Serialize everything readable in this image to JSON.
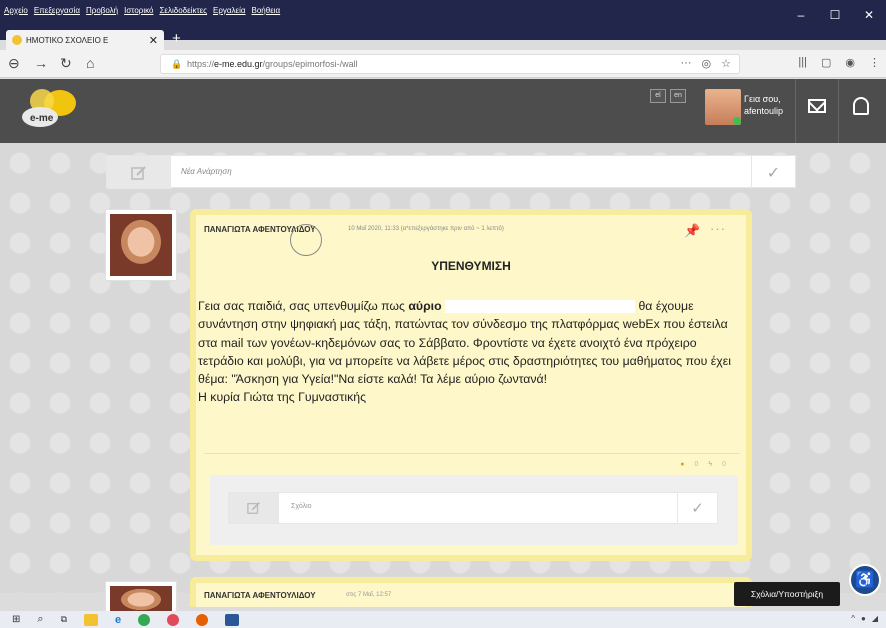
{
  "browser": {
    "menu": [
      "Αρχείο",
      "Επεξεργασία",
      "Προβολή",
      "Ιστορικό",
      "Σελιδοδείκτες",
      "Εργαλεία",
      "Βοήθεια"
    ],
    "tab_title": "ΗΜΟΤΙΚΟ ΣΧΟΛΕΙΟ Ε",
    "tab_close": "✕",
    "new_tab": "+",
    "url_prefix": "https://",
    "url_host": "e-me.edu.gr",
    "url_path": "/groups/epimorfosi-/wall",
    "url_more": "···"
  },
  "header": {
    "lang_el": "el",
    "lang_en": "en",
    "greeting_line1": "Γεια σου,",
    "greeting_line2": "afentoulip"
  },
  "new_post": {
    "placeholder": "Νέα Ανάρτηση"
  },
  "post": {
    "author": "ΠΑΝΑΓΙΩΤΑ ΑΦΕΝΤΟΥΛΙΔΟΥ",
    "meta": "10 Μαΐ 2020, 11:33 (α*επεξεργάστηκε πριν από ~ 1 λεπτό)",
    "title": "ΥΠΕΝΘΥΜΙΣΗ",
    "body_start": "Γεια σας παιδιά, σας υπενθυμίζω πως ",
    "body_bold": "αύριο",
    "body_rest": " θα έχουμε συνάντηση στην ψηφιακή μας τάξη, πατώντας τον σύνδεσμο της πλατφόρμας webEx που έστειλα στα mail των γονέων-κηδεμόνων σας το Σάββατο. Φροντίστε να έχετε ανοιχτό ένα πρόχειρο τετράδιο και μολύβι, για να μπορείτε να λάβετε μέρος στις δραστηριότητες του μαθήματος που έχει θέμα: \"Άσκηση για Υγεία!\"Να είστε καλά! Τα λέμε αύριο ζωντανά!",
    "signature": "Η κυρία Γιώτα της Γυμναστικής",
    "comments_count": "0",
    "likes_count": "0",
    "comment_placeholder": "Σχόλιο"
  },
  "post2": {
    "author": "ΠΑΝΑΓΙΩΤΑ ΑΦΕΝΤΟΥΛΙΔΟΥ",
    "meta": "στις 7 Μαΐ, 12:57"
  },
  "support_label": "Σχόλια/Υποστήριξη",
  "colors": {
    "accent": "#f7ec9a",
    "card": "#fdf7c9",
    "header": "#4e4d4d",
    "titlebar": "#22264a"
  }
}
